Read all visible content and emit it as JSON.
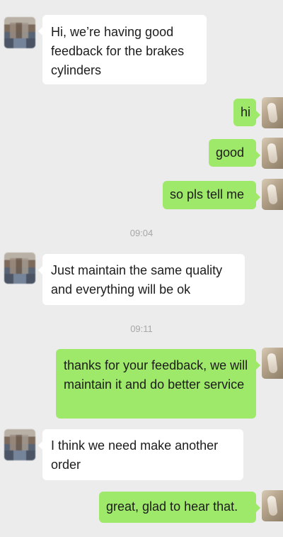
{
  "messages": [
    {
      "side": "left",
      "text": "Hi, we’re having good feedback for the brakes cylinders"
    },
    {
      "side": "right",
      "text": "hi"
    },
    {
      "side": "right",
      "text": "good"
    },
    {
      "side": "right",
      "text": "so pls tell me"
    },
    {
      "side": "time",
      "text": "09:04"
    },
    {
      "side": "left",
      "text": "Just maintain the same quality and everything will be ok"
    },
    {
      "side": "time",
      "text": "09:11"
    },
    {
      "side": "right",
      "text": "thanks for your feedback, we will maintain it and do better service"
    },
    {
      "side": "left",
      "text": "I think we need make another order"
    },
    {
      "side": "right",
      "text": "great, glad to hear that."
    }
  ],
  "colors": {
    "background": "#ececec",
    "incoming_bubble": "#ffffff",
    "outgoing_bubble": "#9ee86a",
    "timestamp": "#a7a7a7"
  }
}
